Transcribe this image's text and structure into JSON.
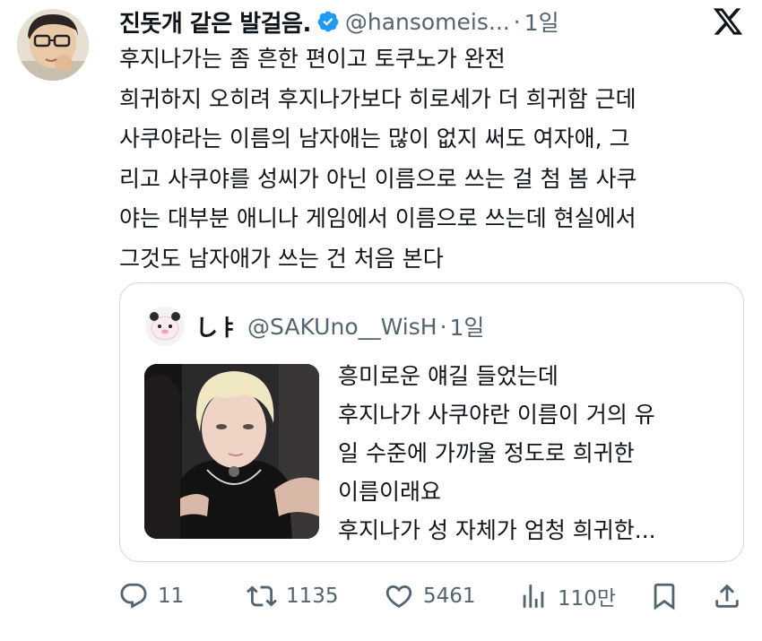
{
  "tweet": {
    "display_name": "진돗개 같은 발걸음.",
    "handle": "@hansomeis...",
    "separator": "·",
    "time": "1일",
    "text": "후지나가는 좀 흔한 편이고 토쿠노가 완전\n희귀하지 오히려 후지나가보다 히로세가 더 희귀함 근데\n사쿠야라는 이름의 남자애는 많이 없지 써도 여자애, 그\n리고 사쿠야를 성씨가 아닌 이름으로 쓰는 걸 첨 봄 사쿠\n야는 대부분 애니나 게임에서 이름으로 쓰는데 현실에서\n그것도 남자애가 쓰는 건 처음 본다",
    "verified_color": "#1d9bf0"
  },
  "quote": {
    "display_name": "しㅑ",
    "handle": "@SAKUno__WisH",
    "separator": "·",
    "time": "1일",
    "text": "흥미로운 얘길 들었는데\n후지나가 사쿠야란 이름이 거의 유\n일 수준에 가까울 정도로 희귀한\n이름이래요\n후지나가 성 자체가 엄청 희귀한..."
  },
  "actions": {
    "reply_count": "11",
    "retweet_count": "1135",
    "like_count": "5461",
    "views_count": "110만"
  },
  "icons": {
    "verified": "verified-badge-icon",
    "brand": "x-logo-icon",
    "reply": "reply-icon",
    "retweet": "retweet-icon",
    "like": "heart-icon",
    "views": "views-icon",
    "bookmark": "bookmark-icon",
    "share": "share-icon"
  }
}
